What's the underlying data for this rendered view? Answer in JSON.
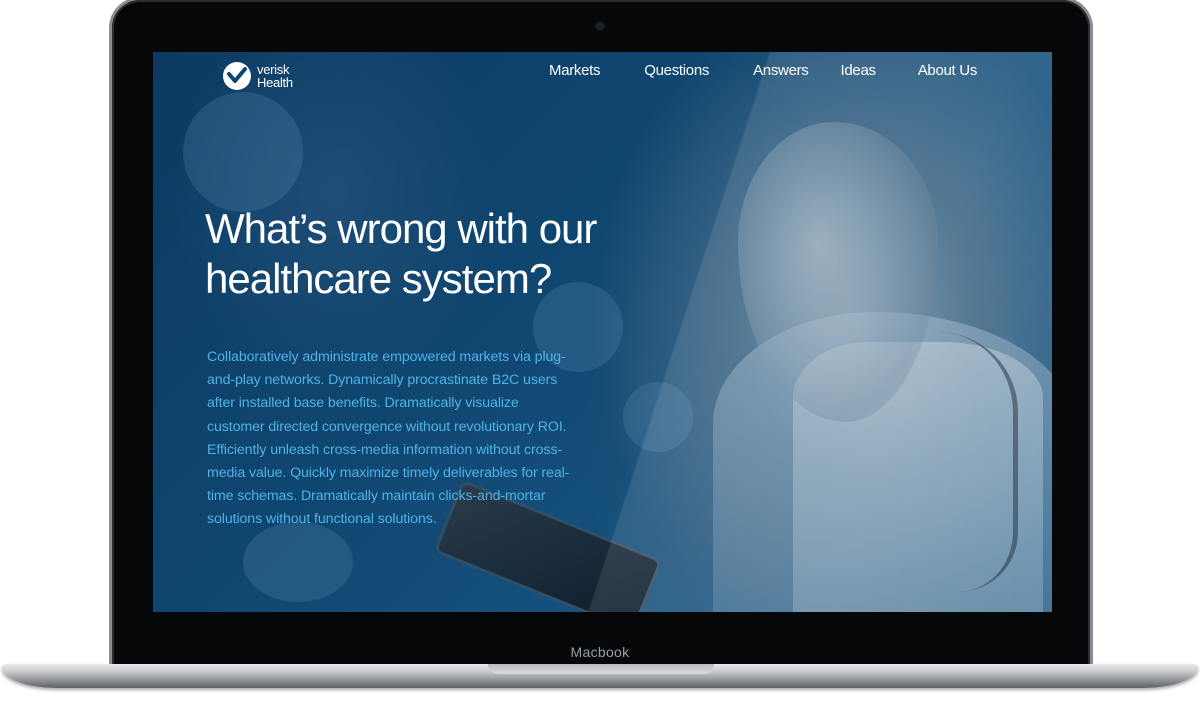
{
  "device": {
    "label": "Macbook"
  },
  "site": {
    "logo": {
      "line1": "verisk",
      "line2": "Health",
      "icon": "check-circle-icon"
    },
    "nav": {
      "items": [
        {
          "label": "Markets"
        },
        {
          "label": "Questions"
        },
        {
          "label": "Answers"
        },
        {
          "label": "Ideas"
        },
        {
          "label": "About Us"
        }
      ]
    },
    "hero": {
      "title": "What’s wrong with our healthcare system?",
      "body": "Collaboratively administrate empowered markets via plug-and-play networks. Dynamically procrastinate B2C users after installed base benefits. Dramatically visualize customer directed convergence without revolutionary ROI. Efficiently unleash cross-media information without cross-media value. Quickly maximize timely deliverables for real-time schemas. Dramatically maintain clicks-and-mortar solutions without functional solutions."
    },
    "colors": {
      "brand_blue": "#0f4670",
      "body_text": "#4fb3e6",
      "nav_text": "#ffffff"
    }
  }
}
